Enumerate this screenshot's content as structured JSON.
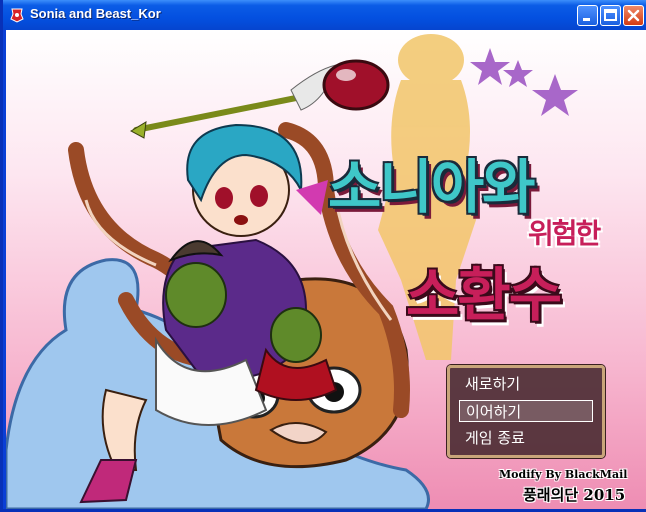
{
  "window": {
    "title": "Sonia and Beast_Kor",
    "icon": "game-app-icon",
    "controls": [
      "minimize-icon",
      "maximize-icon",
      "close-icon"
    ]
  },
  "logo": {
    "line1": "소니아와",
    "line2": "위험한",
    "line3": "소환수"
  },
  "menu": {
    "items": [
      {
        "label": "새로하기",
        "selected": false
      },
      {
        "label": "이어하기",
        "selected": true
      },
      {
        "label": "게임 종료",
        "selected": false
      }
    ]
  },
  "credits": {
    "modify": "Modify By BlackMail",
    "group": "풍래의단 2015"
  },
  "colors": {
    "titlebar": "#0450e0",
    "background_top": "#ffffff",
    "background_bottom": "#ee8db3",
    "logo_teal": "#3fc7c8",
    "logo_crimson": "#c71f5a",
    "menu_bg": "#46282d",
    "menu_border": "#c9a57a"
  }
}
